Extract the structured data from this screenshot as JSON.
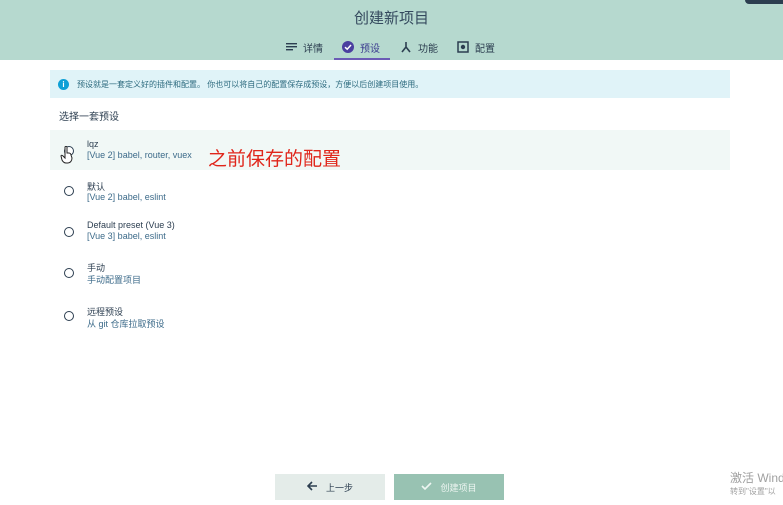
{
  "header": {
    "title": "创建新项目",
    "tabs": [
      {
        "label": "详情",
        "icon": "list-icon",
        "active": false
      },
      {
        "label": "预设",
        "icon": "check-circle-icon",
        "active": true
      },
      {
        "label": "功能",
        "icon": "fork-icon",
        "active": false
      },
      {
        "label": "配置",
        "icon": "gear-icon",
        "active": false
      }
    ]
  },
  "info": {
    "icon": "info-icon",
    "text": "预设就是一套定义好的插件和配置。 你也可以将自己的配置保存成预设，方便以后创建项目使用。"
  },
  "section_title": "选择一套预设",
  "presets": [
    {
      "name": "lqz",
      "desc": "[Vue 2] babel, router, vuex"
    },
    {
      "name": "默认",
      "desc": "[Vue 2] babel, eslint"
    },
    {
      "name": "Default preset (Vue 3)",
      "desc": "[Vue 3] babel, eslint"
    },
    {
      "name": "手动",
      "desc": "手动配置项目"
    },
    {
      "name": "远程预设",
      "desc": "从 git 仓库拉取预设"
    }
  ],
  "annotation": "之前保存的配置",
  "buttons": {
    "prev_label": "上一步",
    "create_label": "创建项目"
  },
  "watermark": {
    "line1": "激活 Wind",
    "line2": "转到\"设置\"以"
  },
  "colors": {
    "header_bg": "#b6d9cf",
    "active_tab": "#6b5bb5",
    "info_bg": "#e0f3f8",
    "annotation": "#e0261b",
    "create_button": "#98c2b2"
  }
}
